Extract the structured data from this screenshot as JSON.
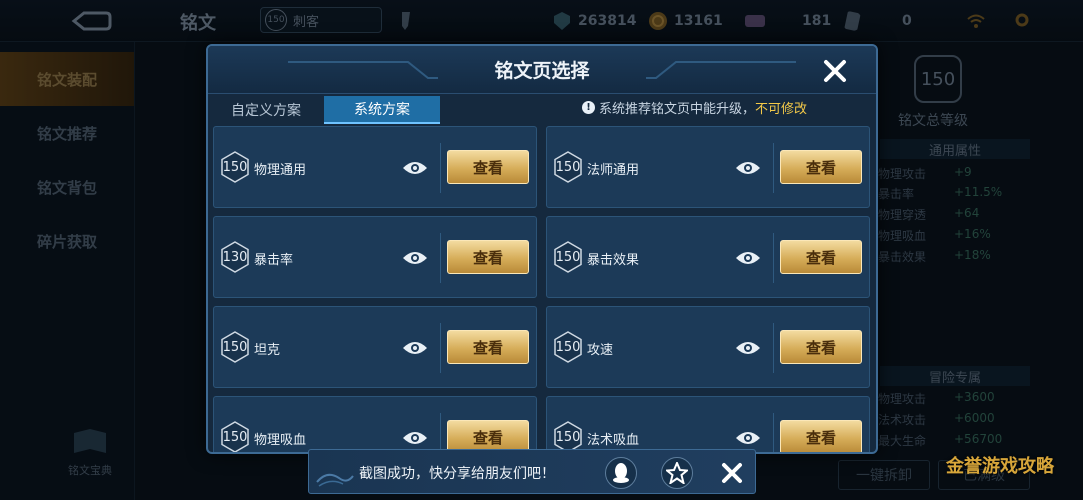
{
  "topbar": {
    "title": "铭文",
    "hero_level": "150",
    "hero_name": "刺客",
    "resources": [
      {
        "icon": "shield-coin-icon",
        "value": "263814"
      },
      {
        "icon": "gold-coin-icon",
        "value": "13161"
      },
      {
        "icon": "gem-icon",
        "value": "181"
      },
      {
        "icon": "card-icon",
        "value": "0"
      }
    ]
  },
  "sidebar": {
    "items": [
      {
        "label": "铭文装配",
        "active": true
      },
      {
        "label": "铭文推荐",
        "active": false
      },
      {
        "label": "铭文背包",
        "active": false
      },
      {
        "label": "碎片获取",
        "active": false
      }
    ],
    "book_label": "铭文宝典"
  },
  "right_panel": {
    "level": "150",
    "level_label": "铭文总等级",
    "section_general": "通用属性",
    "general_stats": [
      {
        "name": "物理攻击",
        "value": "+9"
      },
      {
        "name": "暴击率",
        "value": "+11.5%"
      },
      {
        "name": "物理穿透",
        "value": "+64"
      },
      {
        "name": "物理吸血",
        "value": "+16%"
      },
      {
        "name": "暴击效果",
        "value": "+18%"
      }
    ],
    "section_adventure": "冒险专属",
    "adventure_stats": [
      {
        "name": "物理攻击",
        "value": "+3600"
      },
      {
        "name": "法术攻击",
        "value": "+6000"
      },
      {
        "name": "最大生命",
        "value": "+56700"
      }
    ],
    "btn_remove_all": "一键拆卸",
    "btn_full": "已满级"
  },
  "modal": {
    "title": "铭文页选择",
    "tabs": [
      {
        "label": "自定义方案",
        "active": false
      },
      {
        "label": "系统方案",
        "active": true
      }
    ],
    "notice_text": "系统推荐铭文页中能升级，",
    "notice_warn": "不可修改",
    "view_label": "查看",
    "cards": [
      {
        "level": "150",
        "name": "物理通用"
      },
      {
        "level": "150",
        "name": "法师通用"
      },
      {
        "level": "130",
        "name": "暴击率"
      },
      {
        "level": "150",
        "name": "暴击效果"
      },
      {
        "level": "150",
        "name": "坦克"
      },
      {
        "level": "150",
        "name": "攻速"
      },
      {
        "level": "150",
        "name": "物理吸血"
      },
      {
        "level": "150",
        "name": "法术吸血"
      }
    ]
  },
  "toast": {
    "message": "截图成功，快分享给朋友们吧！"
  },
  "watermark": "金誉游戏攻略",
  "colors": {
    "accent_blue": "#1f6ea5",
    "gold_button": "#d6ad59",
    "warning": "#f3c948"
  }
}
